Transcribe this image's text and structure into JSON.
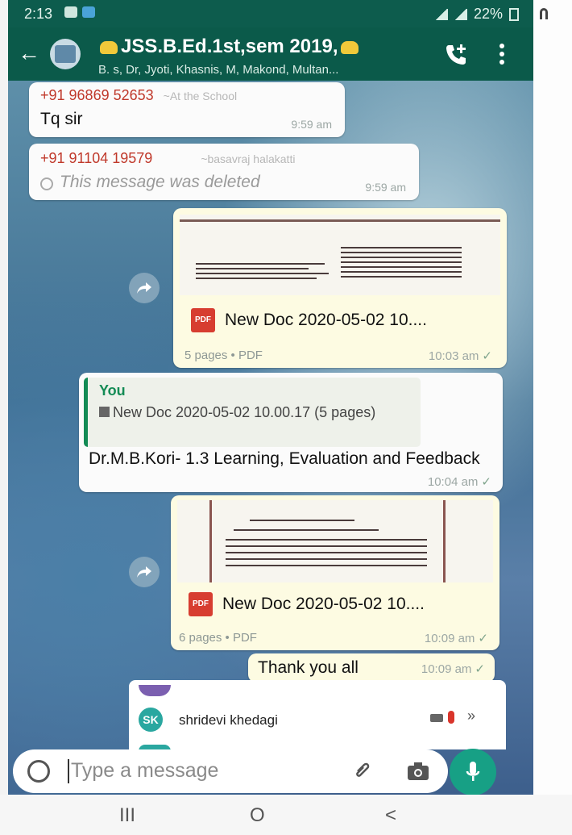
{
  "status": {
    "time": "2:13",
    "battery": "22%"
  },
  "header": {
    "title": "JSS.B.Ed.1st,sem 2019,",
    "subtitle": "B. s, Dr, Jyoti, Khasnis, M, Makond, Multan...",
    "back_icon": "back-arrow-icon",
    "call_icon": "add-call-icon",
    "menu_icon": "more-vert-icon"
  },
  "messages": [
    {
      "sender": "+91 96869 52653",
      "aka": "~At the School",
      "text": "Tq sir",
      "time": "9:59 am"
    },
    {
      "sender": "+91 91104 19579",
      "aka": "~basavraj halakatti",
      "text": "This message was deleted",
      "time": "9:59 am"
    },
    {
      "doc_name": "New Doc 2020-05-02 10....",
      "doc_meta": "5 pages • PDF",
      "time": "10:03 am"
    },
    {
      "quote_author": "You",
      "quote_text": "New Doc 2020-05-02 10.00.17 (5 pages)",
      "text": "Dr.M.B.Kori- 1.3 Learning, Evaluation and Feedback",
      "time": "10:04 am"
    },
    {
      "doc_name": "New Doc 2020-05-02 10....",
      "doc_meta": "6 pages • PDF",
      "time": "10:09 am"
    },
    {
      "text": "Thank you all",
      "time": "10:09 am"
    }
  ],
  "mention": {
    "initials": "SK",
    "name": "shridevi khedagi"
  },
  "composer": {
    "placeholder": "Type a message"
  },
  "colors": {
    "header": "#0b5a4a",
    "accent": "#17a085",
    "outgoing": "#fdfbe2"
  },
  "nav": {
    "recent": "III",
    "home": "O",
    "back": "<"
  }
}
